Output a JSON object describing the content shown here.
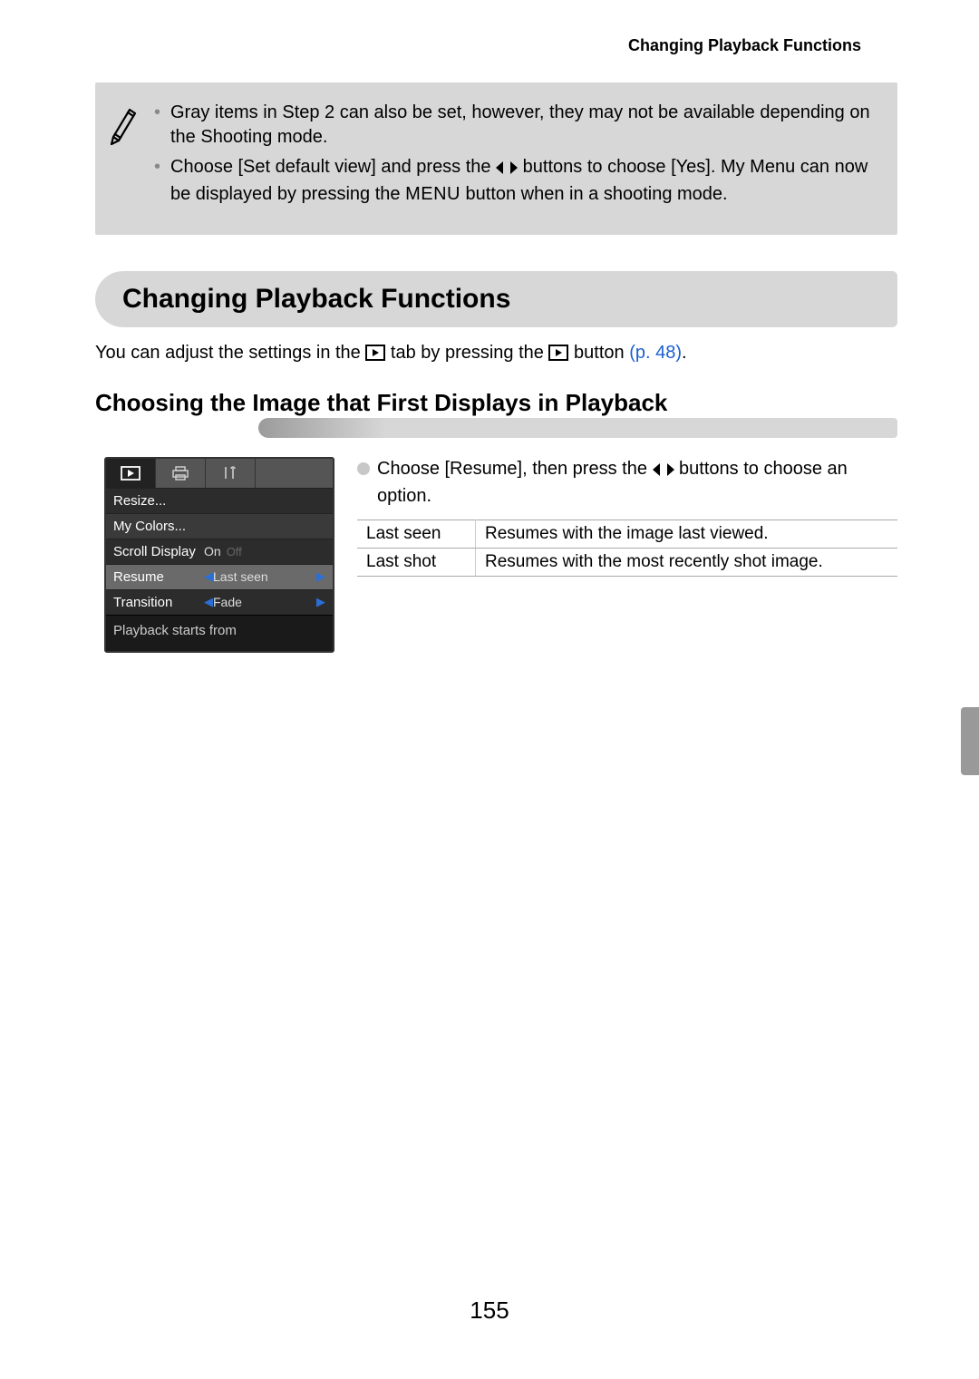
{
  "running_header": "Changing Playback Functions",
  "note": {
    "bullets": [
      {
        "pre": "Gray items in Step 2 can also be set, however, they may not be available depending on the Shooting mode.",
        "has_icons": false
      },
      {
        "pre": "Choose [Set default view] and press the ",
        "mid": " buttons to choose [Yes]. My Menu can now be displayed by pressing the ",
        "menu_word": "MENU",
        "post": " button when in a shooting mode."
      }
    ]
  },
  "section_heading": "Changing Playback Functions",
  "intro": {
    "pre": "You can adjust the settings in the ",
    "mid": " tab by pressing the ",
    "post": " button ",
    "page_ref": "(p. 48)",
    "end": "."
  },
  "subsection_heading": "Choosing the Image that First Displays in Playback",
  "camera_menu": {
    "items": [
      {
        "label": "Resize...",
        "value": ""
      },
      {
        "label": "My Colors...",
        "value": ""
      },
      {
        "label": "Scroll Display",
        "value": "On",
        "off": "Off"
      },
      {
        "label": "Resume",
        "value": "Last seen",
        "selected": true
      },
      {
        "label": "Transition",
        "value": "Fade"
      }
    ],
    "footer": "Playback starts from"
  },
  "instruction": {
    "pre": "Choose [Resume], then press the ",
    "post": " buttons to choose an option."
  },
  "options_table": [
    {
      "name": "Last seen",
      "desc": "Resumes with the image last viewed."
    },
    {
      "name": "Last shot",
      "desc": "Resumes with the most recently shot image."
    }
  ],
  "page_number": "155"
}
